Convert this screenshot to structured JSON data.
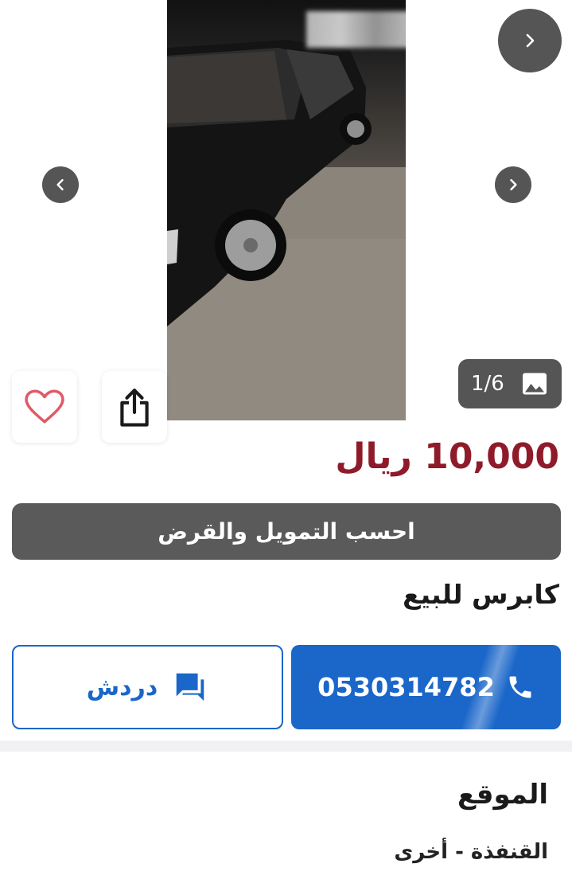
{
  "gallery": {
    "counter": "1/6",
    "icons": {
      "next_top": "chevron-right-icon",
      "prev": "chevron-left-icon",
      "next": "chevron-right-icon",
      "image": "image-icon",
      "favorite": "heart-icon",
      "share": "share-icon"
    }
  },
  "listing": {
    "price": "10,000 ريال",
    "finance_button": "احسب التمويل والقرض",
    "title": "كابرس للبيع"
  },
  "contact": {
    "phone": "0530314782",
    "chat_label": "دردش",
    "icons": {
      "phone": "phone-icon",
      "chat": "chat-icon"
    }
  },
  "location": {
    "heading": "الموقع",
    "value": "القنفذة - أخرى"
  },
  "colors": {
    "price": "#8f1b2a",
    "primary_blue": "#1a66c9",
    "dark_gray": "#5a5a5a",
    "favorite_pink": "#e05a66"
  }
}
